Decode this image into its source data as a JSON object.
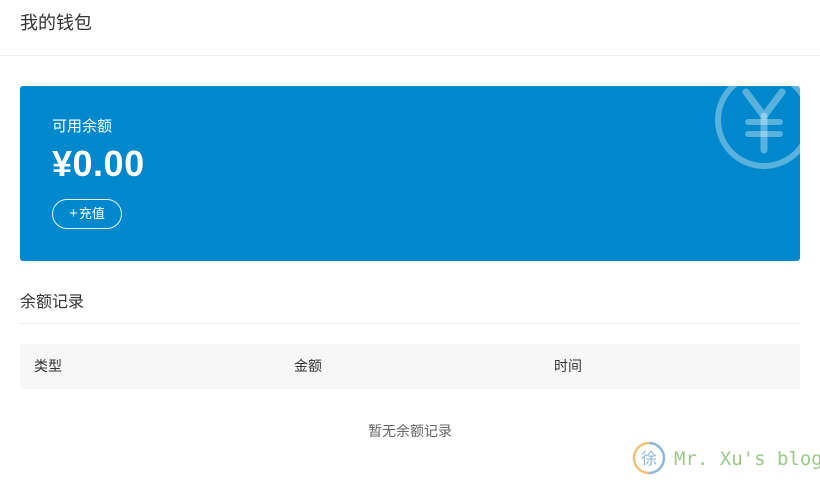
{
  "header": {
    "title": "我的钱包"
  },
  "wallet": {
    "balance_label": "可用余额",
    "balance_amount": "¥0.00",
    "recharge_plus": "+",
    "recharge_label": "充值",
    "icon": "yen-circle-icon",
    "card_color": "#0088cc"
  },
  "records": {
    "title": "余额记录",
    "columns": [
      "类型",
      "金额",
      "时间"
    ],
    "empty_text": "暂无余额记录"
  },
  "watermark": {
    "logo_char": "徐",
    "text": "Mr. Xu's blog"
  }
}
